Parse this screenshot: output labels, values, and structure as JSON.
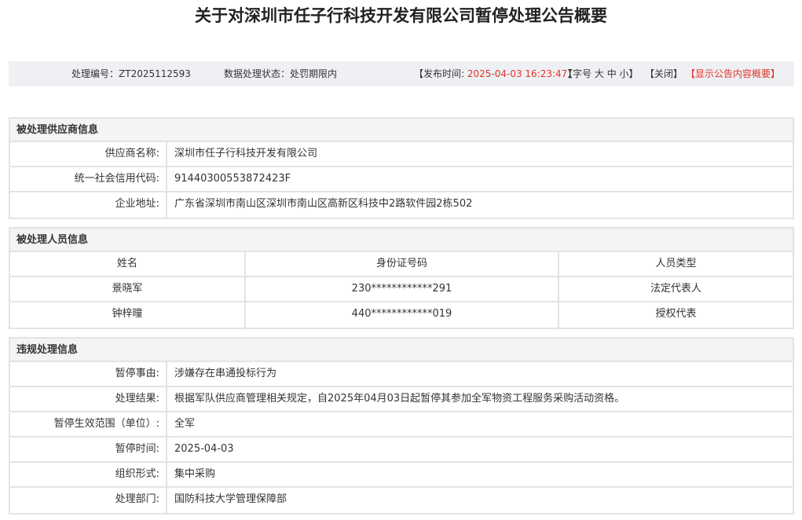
{
  "title": "关于对深圳市任子行科技开发有限公司暂停处理公告概要",
  "infobar": {
    "id_label": "处理编号：",
    "id": "ZT2025112593",
    "status_label": "数据处理状态：",
    "status": "处罚期限内",
    "publish_open": "【发布时间: ",
    "publish_time": "2025-04-03 16:23:47",
    "publish_close": "】",
    "font_label": "【字号",
    "font_large": "大",
    "font_mid": "中",
    "font_small": "小",
    "font_close": "】",
    "close": "【关闭】",
    "show_summary": "【显示公告内容概要】"
  },
  "supplier": {
    "heading": "被处理供应商信息",
    "rows": [
      {
        "label": "供应商名称:",
        "value": "深圳市任子行科技开发有限公司"
      },
      {
        "label": "统一社会信用代码:",
        "value": "91440300553872423F"
      },
      {
        "label": "企业地址:",
        "value": "广东省深圳市南山区深圳市南山区高新区科技中2路软件园2栋502"
      }
    ]
  },
  "persons": {
    "heading": "被处理人员信息",
    "columns": [
      "姓名",
      "身份证号码",
      "人员类型"
    ],
    "rows": [
      [
        "景晓军",
        "230************291",
        "法定代表人"
      ],
      [
        "钟梓曈",
        "440************019",
        "授权代表"
      ]
    ]
  },
  "violation": {
    "heading": "违规处理信息",
    "rows": [
      {
        "label": "暂停事由:",
        "value": "涉嫌存在串通投标行为"
      },
      {
        "label": "处理结果:",
        "value": "根据军队供应商管理相关规定，自2025年04月03日起暂停其参加全军物资工程服务采购活动资格。"
      },
      {
        "label": "暂停生效范围（单位）:",
        "value": "全军"
      },
      {
        "label": "暂停时间:",
        "value": "2025-04-03"
      },
      {
        "label": "组织形式:",
        "value": "集中采购"
      },
      {
        "label": "处理部门:",
        "value": "国防科技大学管理保障部"
      }
    ]
  }
}
